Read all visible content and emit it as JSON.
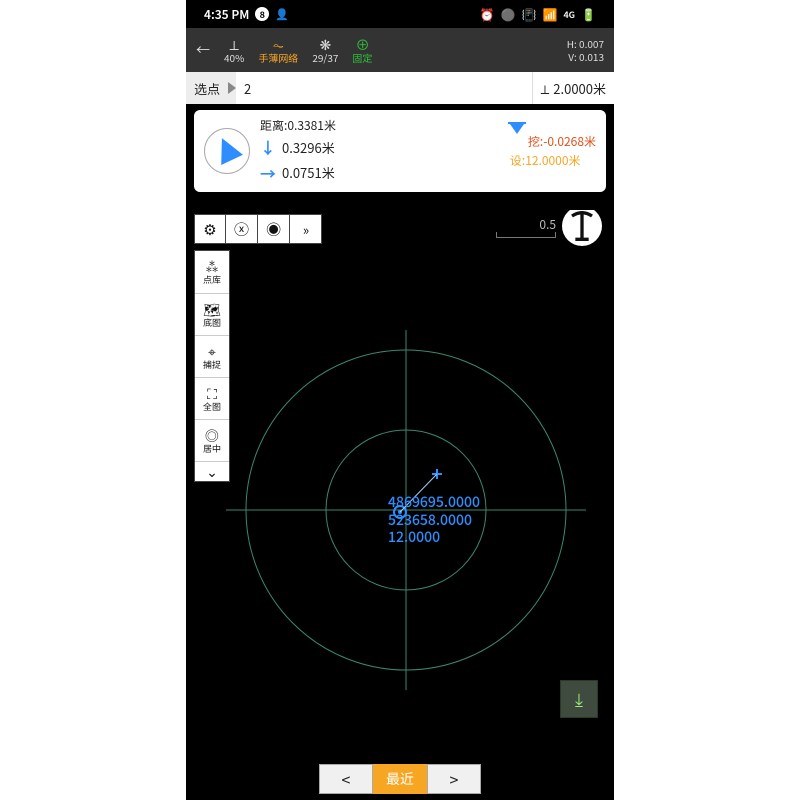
{
  "status": {
    "time": "4:35 PM",
    "notif_count": "8"
  },
  "appbar": {
    "battery_pct": "40%",
    "network_label": "手薄网络",
    "sat_ratio": "29/37",
    "fix_label": "固定",
    "h_value": "H: 0.007",
    "v_value": "V: 0.013"
  },
  "subbar": {
    "label": "选点",
    "point_value": "2",
    "antenna_height": "2.0000米"
  },
  "card": {
    "distance_label": "距离:0.3381米",
    "down_value": "0.3296米",
    "right_value": "0.0751米",
    "cut_label": "挖:",
    "cut_value": "-0.0268米",
    "design_label": "设:",
    "design_value": "12.0000米"
  },
  "toolbar": {
    "settings_icon": "gear",
    "clear_icon": "x-circle",
    "north_icon": "compass-north",
    "expand_icon": "expand"
  },
  "vtool": [
    {
      "icon": "dots",
      "label": "点库"
    },
    {
      "icon": "map",
      "label": "底图"
    },
    {
      "icon": "snap",
      "label": "捕捉"
    },
    {
      "icon": "fullscreen",
      "label": "全图"
    },
    {
      "icon": "center",
      "label": "居中"
    }
  ],
  "map": {
    "scale_label": "0.5",
    "coord_n": "4869695.0000",
    "coord_e": "523658.0000",
    "coord_z": "12.0000"
  },
  "bottom": {
    "recent_label": "最近"
  }
}
